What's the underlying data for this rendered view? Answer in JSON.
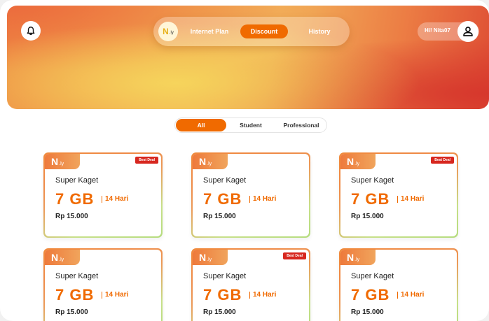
{
  "header": {
    "logo": {
      "n": "N",
      "ly": ".ly"
    },
    "nav": [
      {
        "label": "Internet Plan",
        "active": false
      },
      {
        "label": "Discount",
        "active": true
      },
      {
        "label": "History",
        "active": false
      }
    ],
    "user": {
      "greeting": "Hi! Nita07"
    }
  },
  "filters": [
    {
      "label": "All",
      "active": true
    },
    {
      "label": "Student",
      "active": false
    },
    {
      "label": "Professional",
      "active": false
    }
  ],
  "cards": [
    {
      "brand_n": "N",
      "brand_ly": ".ly",
      "badge": "Best Deal",
      "title": "Super Kaget",
      "amount": "7 GB",
      "days": "14 Hari",
      "price": "Rp 15.000"
    },
    {
      "brand_n": "N",
      "brand_ly": ".ly",
      "badge": "",
      "title": "Super Kaget",
      "amount": "7 GB",
      "days": "14 Hari",
      "price": "Rp 15.000"
    },
    {
      "brand_n": "N",
      "brand_ly": ".ly",
      "badge": "Best Deal",
      "title": "Super Kaget",
      "amount": "7 GB",
      "days": "14 Hari",
      "price": "Rp 15.000"
    },
    {
      "brand_n": "N",
      "brand_ly": ".ly",
      "badge": "",
      "title": "Super Kaget",
      "amount": "7 GB",
      "days": "14 Hari",
      "price": "Rp 15.000"
    },
    {
      "brand_n": "N",
      "brand_ly": ".ly",
      "badge": "Best Deal",
      "title": "Super Kaget",
      "amount": "7 GB",
      "days": "14 Hari",
      "price": "Rp 15.000"
    },
    {
      "brand_n": "N",
      "brand_ly": ".ly",
      "badge": "",
      "title": "Super Kaget",
      "amount": "7 GB",
      "days": "14 Hari",
      "price": "Rp 15.000"
    }
  ],
  "icons": {
    "notification": "bell-icon",
    "profile": "user-icon"
  },
  "colors": {
    "accent": "#f06a00",
    "badge": "#d7271f",
    "logo": "#e7b21f"
  }
}
